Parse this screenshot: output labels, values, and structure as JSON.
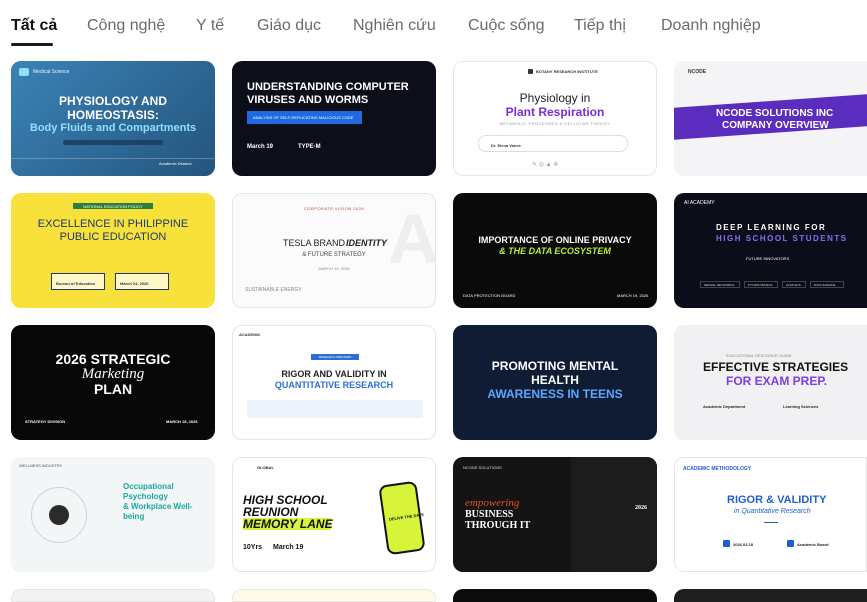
{
  "tabs": [
    {
      "label": "Tất cả",
      "active": true
    },
    {
      "label": "Công nghệ"
    },
    {
      "label": "Y tế"
    },
    {
      "label": "Giáo dục"
    },
    {
      "label": "Nghiên cứu"
    },
    {
      "label": "Cuộc sống"
    },
    {
      "label": "Tiếp thị"
    },
    {
      "label": "Doanh nghiệp"
    }
  ],
  "cards": {
    "c1": {
      "brand": "Medical Science",
      "title_1": "PHYSIOLOGY AND",
      "title_2": "HOMEOSTASIS:",
      "title_3": "Body Fluids and Compartments",
      "band": "Academic Division",
      "colors": {
        "bg": "#2f6f9f",
        "accent": "#8fe0ff"
      }
    },
    "c2": {
      "title_1": "UNDERSTANDING COMPUTER",
      "title_2": "VIRUSES AND WORMS",
      "button": "ANALYSIS OF SELF-REPLICATING MALICIOUS CODE",
      "date": "March 19",
      "label": "TYPE-M",
      "colors": {
        "bg": "#0c0f1a",
        "accent": "#1f6ae0"
      }
    },
    "c3": {
      "brand": "BOTANY RESEARCH INSTITUTE",
      "title_1": "Physiology in",
      "title_2": "Plant Respiration",
      "sub": "METABOLIC PROCESSES & CELLULAR ENERGY",
      "person": "Dr. Elena Vance",
      "colors": {
        "accent": "#7a2cd9"
      }
    },
    "c4": {
      "brand": "NCODE",
      "title_1": "NCODE SOLUTIONS INC",
      "title_2": "COMPANY OVERVIEW",
      "colors": {
        "accent": "#5b2dbf"
      }
    },
    "c5": {
      "tag": "NATIONAL EDUCATION POLICY",
      "title_1": "EXCELLENCE IN PHILIPPINE",
      "title_2": "PUBLIC EDUCATION",
      "box_1": "Bureau of Education",
      "box_2": "March 24, 2026",
      "colors": {
        "bg": "#f8e13a"
      }
    },
    "c6": {
      "tag": "CORPORATE VISION 2026",
      "title_1": "TESLA BRAND",
      "title_2": "IDENTITY",
      "title_3": "& FUTURE STRATEGY",
      "date": "MARCH 19, 2026",
      "footer": "SUSTAINABLE ENERGY",
      "letter": "A"
    },
    "c7": {
      "title_1": "IMPORTANCE OF ONLINE PRIVACY",
      "title_2": "& THE DATA ECOSYSTEM",
      "left": "DATA PROTECTION BOARD",
      "right": "MARCH 19, 2026",
      "colors": {
        "accent": "#b6f03b"
      }
    },
    "c8": {
      "brand": "AI ACADEMY",
      "title_1": "DEEP LEARNING FOR",
      "title_2": "HIGH SCHOOL STUDENTS",
      "sub": "FUTURE INNOVATORS",
      "pills": [
        "NEURAL NETWORKS",
        "PYTHON BASICS",
        "AI ETHICS",
        "DATA SCIENCE"
      ],
      "colors": {
        "accent": "#8d6bff"
      }
    },
    "c9": {
      "title_1": "2026 STRATEGIC",
      "title_2": "Marketing",
      "title_3": "PLAN",
      "left": "STRATEGY DIVISION",
      "right": "MARCH 18, 2026"
    },
    "c10": {
      "brand": "ACADEMIC",
      "tag": "RESEARCH METHODS",
      "title_1": "RIGOR AND VALIDITY IN",
      "title_2": "QUANTITATIVE RESEARCH",
      "colors": {
        "accent": "#2b6fd6"
      }
    },
    "c11": {
      "title_1": "PROMOTING MENTAL",
      "title_2": "HEALTH",
      "title_3": "AWARENESS IN TEENS",
      "colors": {
        "bg": "#0f1c33",
        "accent": "#5aa8ff"
      }
    },
    "c12": {
      "tag": "EDUCATIONAL RESOURCE GUIDE",
      "title_1": "EFFECTIVE STRATEGIES",
      "title_2": "FOR EXAM PREP.",
      "left": "Academic Department",
      "right": "Learning Sciences",
      "colors": {
        "accent": "#7b3fe4"
      }
    },
    "c13": {
      "brand": "WELLNESS INDUSTRY",
      "title_1": "Occupational",
      "title_2": "Psychology",
      "title_3": "& Workplace Well-",
      "title_4": "being",
      "colors": {
        "accent": "#19a8a0"
      }
    },
    "c14": {
      "brand": "GLOBAL",
      "title_1": "HIGH SCHOOL",
      "title_2": "REUNION",
      "title_3": "MEMORY LANE",
      "years": "10Yrs",
      "date": "March 19",
      "phone_text": "DELIVE THE DATE",
      "colors": {
        "accent": "#d7f33a"
      }
    },
    "c15": {
      "brand": "NCODE SOLUTIONS",
      "title_1": "empowering",
      "title_2": "BUSINESS",
      "title_3": "THROUGH IT",
      "year": "2026",
      "colors": {
        "accent": "#e0542a"
      }
    },
    "c16": {
      "brand": "ACADEMIC METHODOLOGY",
      "title_1": "RIGOR & VALIDITY",
      "title_2": "in Quantitative Research",
      "date": "2026.03.18",
      "label": "Academic Board",
      "colors": {
        "accent": "#1f5fd0"
      }
    }
  }
}
